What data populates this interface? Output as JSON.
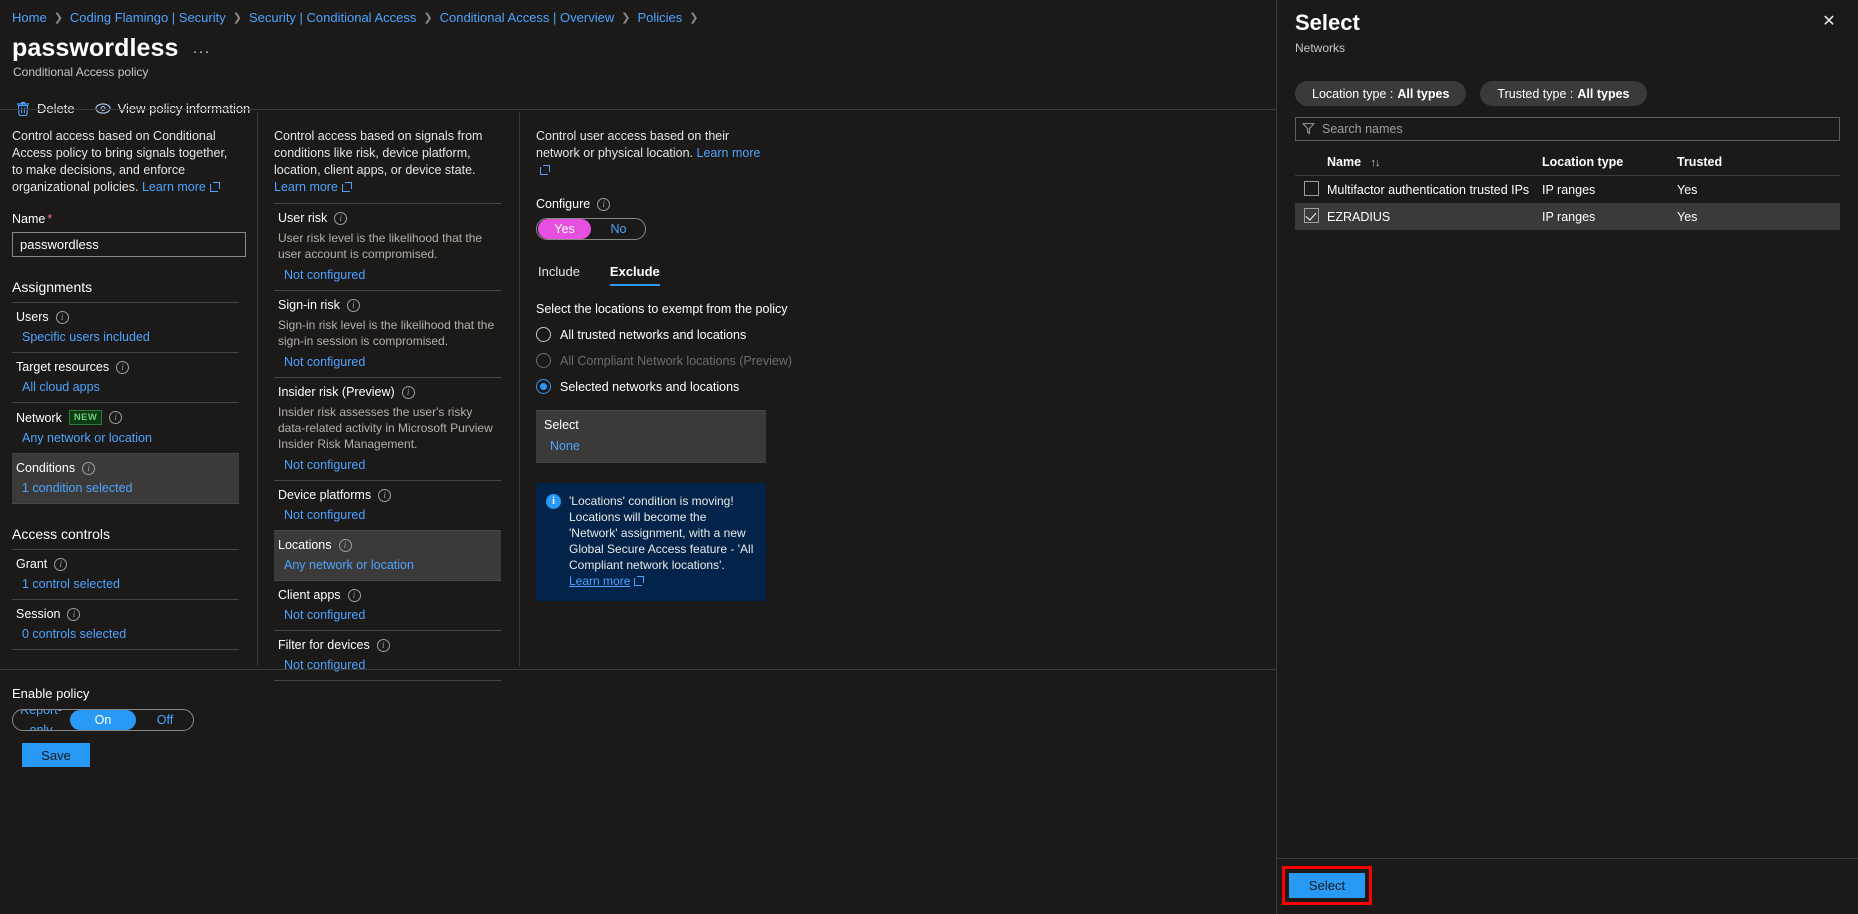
{
  "breadcrumb": [
    "Home",
    "Coding Flamingo | Security",
    "Security | Conditional Access",
    "Conditional Access | Overview",
    "Policies"
  ],
  "header": {
    "title": "passwordless",
    "ellipsis": "···",
    "subtitle": "Conditional Access policy"
  },
  "commandbar": {
    "delete_label": "Delete",
    "view_policy_label": "View policy information"
  },
  "assignments_column": {
    "intro": "Control access based on Conditional Access policy to bring signals together, to make decisions, and enforce organizational policies.",
    "learn_more": "Learn more",
    "name_label": "Name",
    "name_value": "passwordless",
    "section_assignments": "Assignments",
    "section_access_controls": "Access controls",
    "items": [
      {
        "label": "Users",
        "value": "Specific users included",
        "selected": false
      },
      {
        "label": "Target resources",
        "value": "All cloud apps",
        "selected": false
      },
      {
        "label": "Network",
        "value": "Any network or location",
        "selected": false,
        "badge": "NEW"
      },
      {
        "label": "Conditions",
        "value": "1 condition selected",
        "selected": true
      }
    ],
    "access_items": [
      {
        "label": "Grant",
        "value": "1 control selected",
        "selected": false
      },
      {
        "label": "Session",
        "value": "0 controls selected",
        "selected": false
      }
    ]
  },
  "conditions_column": {
    "intro": "Control access based on signals from conditions like risk, device platform, location, client apps, or device state.",
    "learn_more": "Learn more",
    "items": [
      {
        "label": "User risk",
        "desc": "User risk level is the likelihood that the user account is compromised.",
        "value": "Not configured",
        "selected": false
      },
      {
        "label": "Sign-in risk",
        "desc": "Sign-in risk level is the likelihood that the sign-in session is compromised.",
        "value": "Not configured",
        "selected": false
      },
      {
        "label": "Insider risk (Preview)",
        "desc": "Insider risk assesses the user's risky data-related activity in Microsoft Purview Insider Risk Management.",
        "value": "Not configured",
        "selected": false
      },
      {
        "label": "Device platforms",
        "desc": "",
        "value": "Not configured",
        "selected": false
      },
      {
        "label": "Locations",
        "desc": "",
        "value": "Any network or location",
        "selected": true
      },
      {
        "label": "Client apps",
        "desc": "",
        "value": "Not configured",
        "selected": false
      },
      {
        "label": "Filter for devices",
        "desc": "",
        "value": "Not configured",
        "selected": false
      }
    ]
  },
  "locations_column": {
    "intro": "Control user access based on their network or physical location.",
    "learn_more": "Learn more",
    "configure_label": "Configure",
    "configure_yes": "Yes",
    "configure_no": "No",
    "configure_selected": "Yes",
    "tabs": [
      {
        "label": "Include",
        "active": false
      },
      {
        "label": "Exclude",
        "active": true
      }
    ],
    "prompt": "Select the locations to exempt from the policy",
    "radios": [
      {
        "label": "All trusted networks and locations",
        "checked": false,
        "disabled": false
      },
      {
        "label": "All Compliant Network locations (Preview)",
        "checked": false,
        "disabled": true
      },
      {
        "label": "Selected networks and locations",
        "checked": true,
        "disabled": false
      }
    ],
    "select_label": "Select",
    "select_value": "None",
    "info_banner": {
      "icon": "info-icon",
      "text_before": "'Locations' condition is moving! Locations will become the 'Network' assignment, with a new Global Secure Access feature - 'All Compliant network locations'.",
      "link": "Learn more"
    }
  },
  "footer": {
    "enable_label": "Enable policy",
    "enable_options": [
      "Report-only",
      "On",
      "Off"
    ],
    "enable_selected": "On",
    "save_label": "Save"
  },
  "flyout": {
    "title": "Select",
    "subtitle": "Networks",
    "close_icon": "close-icon",
    "filters": [
      {
        "prefix": "Location type :",
        "value": "All types"
      },
      {
        "prefix": "Trusted type :",
        "value": "All types"
      }
    ],
    "search_placeholder": "Search names",
    "table": {
      "columns": [
        "Name",
        "Location type",
        "Trusted"
      ],
      "sort_icon": "sort-ascending-icon",
      "rows": [
        {
          "checked": false,
          "name": "Multifactor authentication trusted IPs",
          "location_type": "IP ranges",
          "trusted": "Yes"
        },
        {
          "checked": true,
          "name": "EZRADIUS",
          "location_type": "IP ranges",
          "trusted": "Yes"
        }
      ]
    },
    "select_button": "Select"
  },
  "colors": {
    "accent_blue": "#2899f5",
    "link_blue": "#4da3ff",
    "magenta_toggle": "#e74fe0",
    "highlight_red": "#ff0000",
    "info_banner_bg": "#02234a",
    "selected_row_bg": "#3b3a39"
  }
}
